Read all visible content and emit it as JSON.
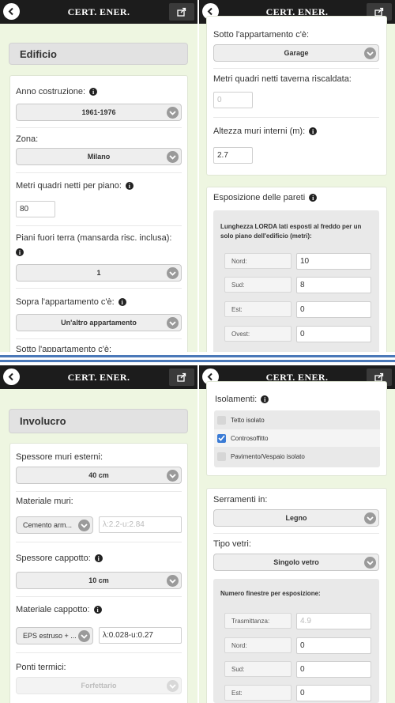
{
  "app": {
    "title": "CERT. ENER."
  },
  "icons": {
    "back": "back-arrow-icon",
    "share": "share-icon",
    "info": "info-icon",
    "chevron": "chevron-down-icon",
    "check": "checkbox-checked-icon"
  },
  "colors": {
    "topbar": "#1c1c1c",
    "background": "#eef6e1",
    "divider": "#4a78b8",
    "checkbox": "#3a7bd5"
  },
  "panel1": {
    "header": "Edificio",
    "anno_label": "Anno costruzione:",
    "anno_value": "1961-1976",
    "zona_label": "Zona:",
    "zona_value": "Milano",
    "mq_label": "Metri quadri netti per piano:",
    "mq_value": "80",
    "piani_label": "Piani fuori terra (mansarda risc. inclusa):",
    "piani_value": "1",
    "sopra_label": "Sopra l'appartamento c'è:",
    "sopra_value": "Un'altro appartamento",
    "sotto_label": "Sotto l'appartamento c'è:"
  },
  "panel2": {
    "sotto_label": "Sotto l'appartamento c'è:",
    "sotto_value": "Garage",
    "taverna_label": "Metri quadri netti taverna riscaldata:",
    "taverna_placeholder": "0",
    "altezza_label": "Altezza muri interni (m):",
    "altezza_value": "2.7",
    "esposizione_label": "Esposizione delle pareti",
    "lorda_text": "Lunghezza LORDA lati esposti al freddo per un solo piano dell'edificio (metri):",
    "rows": [
      {
        "label": "Nord:",
        "value": "10"
      },
      {
        "label": "Sud:",
        "value": "8"
      },
      {
        "label": "Est:",
        "value": "0"
      },
      {
        "label": "Ovest:",
        "value": "0"
      }
    ]
  },
  "panel3": {
    "header": "Involucro",
    "spessore_muri_label": "Spessore muri esterni:",
    "spessore_muri_value": "40 cm",
    "materiale_muri_label": "Materiale muri:",
    "materiale_muri_value": "Cemento arm...",
    "materiale_muri_info": "λ:2.2-u:2.84",
    "spessore_cappotto_label": "Spessore cappotto:",
    "spessore_cappotto_value": "10 cm",
    "materiale_cappotto_label": "Materiale cappotto:",
    "materiale_cappotto_value": "EPS estruso + ...",
    "materiale_cappotto_info": "λ:0.028-u:0.27",
    "ponti_label": "Ponti termici:",
    "ponti_value": "Forfettario"
  },
  "panel4": {
    "isolamenti_label": "Isolamenti:",
    "isolamenti": [
      {
        "label": "Tetto isolato",
        "checked": false
      },
      {
        "label": "Controsoffitto",
        "checked": true
      },
      {
        "label": "Pavimento/Vespaio isolato",
        "checked": false
      }
    ],
    "serramenti_label": "Serramenti in:",
    "serramenti_value": "Legno",
    "vetri_label": "Tipo vetri:",
    "vetri_value": "Singolo vetro",
    "finestre_label": "Numero finestre per esposizione:",
    "trasmittanza_label": "Trasmittanza:",
    "trasmittanza_value": "4.9",
    "rows": [
      {
        "label": "Nord:",
        "value": "0"
      },
      {
        "label": "Sud:",
        "value": "0"
      },
      {
        "label": "Est:",
        "value": "0"
      }
    ]
  }
}
